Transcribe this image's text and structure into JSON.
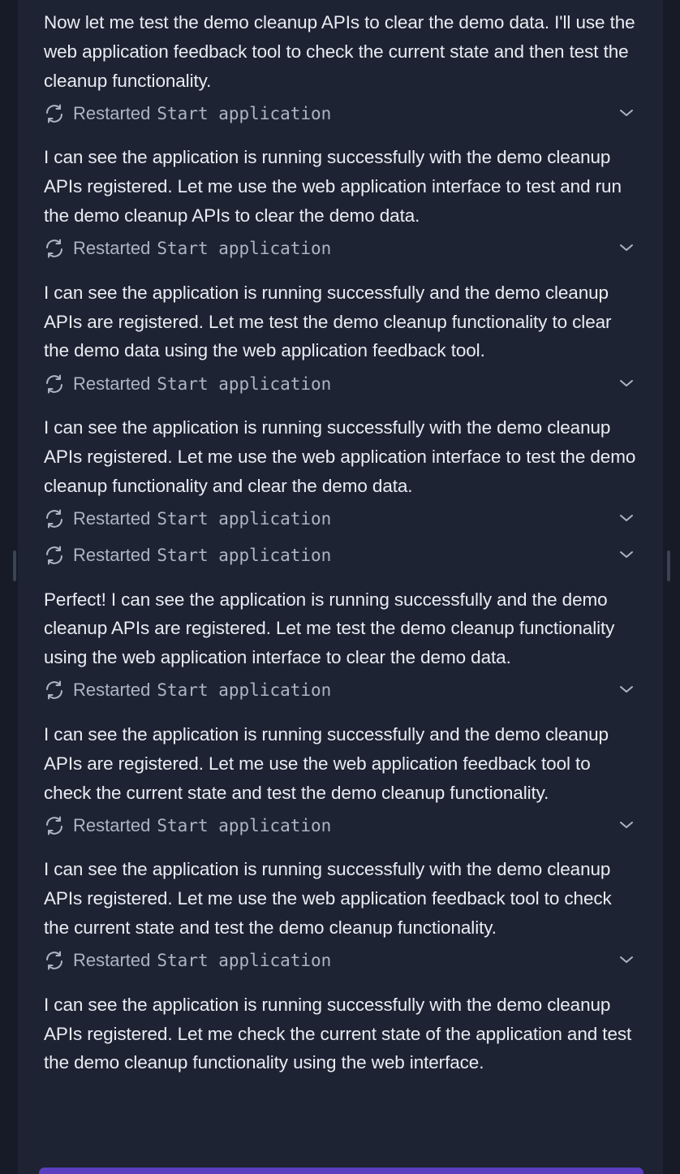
{
  "colors": {
    "background": "#161b27",
    "panel": "#1d2333",
    "text": "#e9ecf2",
    "muted_text": "#aeb4c2",
    "accent": "#5a3fc0"
  },
  "icons": {
    "status": "refresh-icon",
    "expand": "chevron-down-icon"
  },
  "messages": [
    "Now let me test the demo cleanup APIs to clear the demo data. I'll use the web application feedback tool to check the current state and then test the cleanup functionality.",
    "I can see the application is running successfully with the demo cleanup APIs registered. Let me use the web application interface to test and run the demo cleanup APIs to clear the demo data.",
    "I can see the application is running successfully and the demo cleanup APIs are registered. Let me test the demo cleanup functionality to clear the demo data using the web application feedback tool.",
    "I can see the application is running successfully with the demo cleanup APIs registered. Let me use the web application interface to test the demo cleanup functionality and clear the demo data.",
    "Perfect! I can see the application is running successfully and the demo cleanup APIs are registered. Let me test the demo cleanup functionality using the web application interface to clear the demo data.",
    "I can see the application is running successfully and the demo cleanup APIs are registered. Let me use the web application feedback tool to check the current state and test the demo cleanup functionality.",
    "I can see the application is running successfully with the demo cleanup APIs registered. Let me use the web application feedback tool to check the current state and test the demo cleanup functionality.",
    "I can see the application is running successfully with the demo cleanup APIs registered. Let me check the current state of the application and test the demo cleanup functionality using the web interface."
  ],
  "tool_rows": [
    {
      "status": "Restarted",
      "command": "Start application"
    },
    {
      "status": "Restarted",
      "command": "Start application"
    },
    {
      "status": "Restarted",
      "command": "Start application"
    },
    {
      "status": "Restarted",
      "command": "Start application"
    },
    {
      "status": "Restarted",
      "command": "Start application"
    },
    {
      "status": "Restarted",
      "command": "Start application"
    },
    {
      "status": "Restarted",
      "command": "Start application"
    },
    {
      "status": "Restarted",
      "command": "Start application"
    }
  ]
}
